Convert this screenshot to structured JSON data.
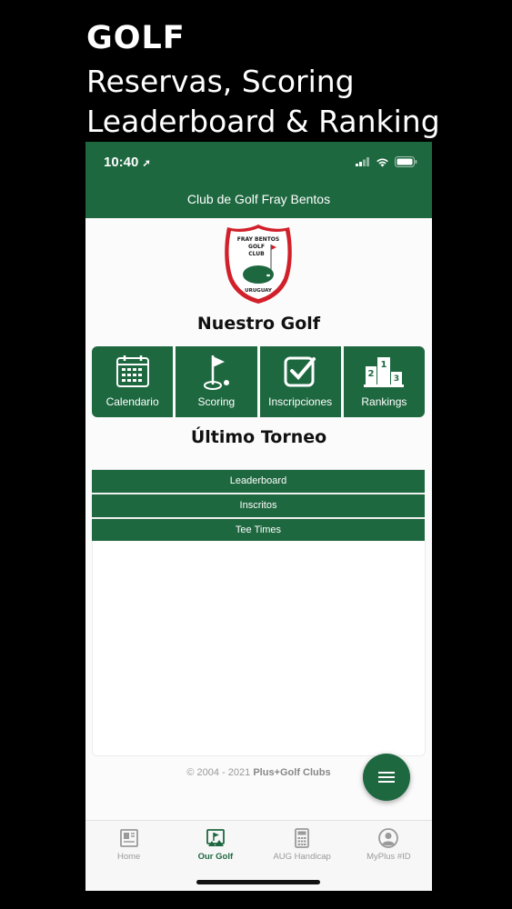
{
  "promo": {
    "title": "GOLF",
    "line1": "Reservas, Scoring",
    "line2": "Leaderboard & Ranking"
  },
  "status_bar": {
    "time": "10:40"
  },
  "header": {
    "title": "Club de Golf Fray Bentos"
  },
  "logo": {
    "line1": "FRAY BENTOS",
    "line2": "GOLF",
    "line3": "CLUB",
    "country": "URUGUAY"
  },
  "sections": {
    "our_golf": "Nuestro Golf",
    "last_tournament": "Último Torneo"
  },
  "tiles": [
    {
      "label": "Calendario",
      "icon": "calendar-icon"
    },
    {
      "label": "Scoring",
      "icon": "flag-icon"
    },
    {
      "label": "Inscripciones",
      "icon": "checkbox-icon"
    },
    {
      "label": "Rankings",
      "icon": "podium-icon"
    }
  ],
  "podium": {
    "first": "1",
    "second": "2",
    "third": "3"
  },
  "tournament_tabs": [
    "Leaderboard",
    "Inscritos",
    "Tee Times"
  ],
  "footer": {
    "copyright_prefix": "© 2004 - 2021 ",
    "brand": "Plus+Golf Clubs"
  },
  "bottom_nav": [
    {
      "label": "Home",
      "icon": "home-icon",
      "active": false
    },
    {
      "label": "Our Golf",
      "icon": "our-golf-icon",
      "active": true
    },
    {
      "label": "AUG Handicap",
      "icon": "calculator-icon",
      "active": false
    },
    {
      "label": "MyPlus #ID",
      "icon": "user-icon",
      "active": false
    }
  ],
  "colors": {
    "primary": "#1e6840",
    "logo_red": "#d1202a",
    "inactive": "#9a9a9a"
  }
}
